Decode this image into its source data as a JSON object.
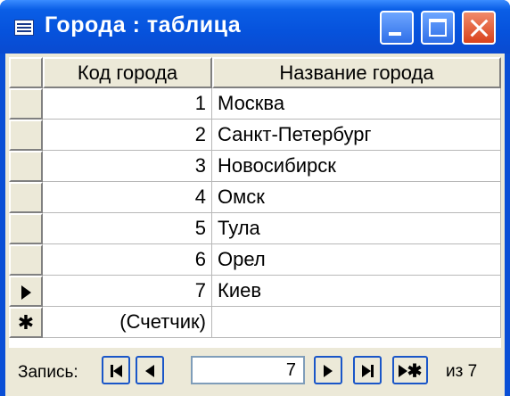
{
  "window": {
    "title": "Города : таблица",
    "accent_color": "#0a4fd6",
    "close_color": "#d9431c"
  },
  "table": {
    "columns": [
      "Код города",
      "Название города"
    ],
    "rows": [
      {
        "code": "1",
        "name": "Москва"
      },
      {
        "code": "2",
        "name": "Санкт-Петербург"
      },
      {
        "code": "3",
        "name": "Новосибирск"
      },
      {
        "code": "4",
        "name": "Омск"
      },
      {
        "code": "5",
        "name": "Тула"
      },
      {
        "code": "6",
        "name": "Орел"
      },
      {
        "code": "7",
        "name": "Киев"
      }
    ],
    "new_row": {
      "selector": "✱",
      "code": "(Счетчик)",
      "name": ""
    },
    "current_row_indicator": "right-triangle-icon"
  },
  "navigator": {
    "label": "Запись:",
    "current_record": "7",
    "of_text": "из 7",
    "buttons": [
      "first-record-icon",
      "previous-record-icon",
      "next-record-icon",
      "last-record-icon",
      "new-record-icon"
    ]
  }
}
